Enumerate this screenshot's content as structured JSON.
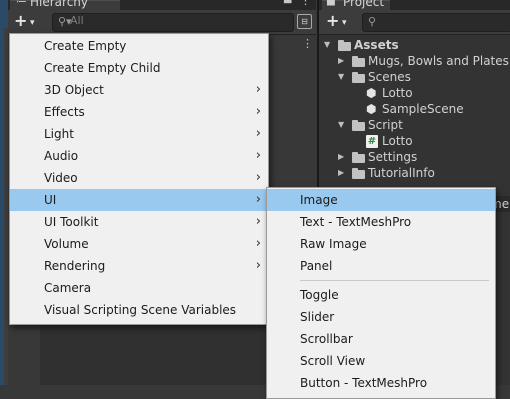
{
  "hierarchy": {
    "tab_icon": "≔",
    "title": "Hierarchy",
    "lock_icon": "🔒",
    "menu_icon": "⋮",
    "add_plus": "+",
    "add_caret": "▾",
    "search_icon": "search-icon",
    "search_prefix": "⚲▾",
    "search_placeholder": "All",
    "filter_icon": "⊟",
    "more_icon": "⋮"
  },
  "project": {
    "tab_icon": "▇",
    "title": "Project",
    "add_plus": "+",
    "add_caret": "▾",
    "search_prefix": "⚲",
    "overflow_text": "me",
    "tree": [
      {
        "label": "Assets",
        "depth": 0,
        "arrow": "▼",
        "icon": "folder-open-icon"
      },
      {
        "label": "Mugs, Bowls and Plates",
        "depth": 1,
        "arrow": "▶",
        "icon": "folder-icon"
      },
      {
        "label": "Scenes",
        "depth": 1,
        "arrow": "▼",
        "icon": "folder-open-icon"
      },
      {
        "label": "Lotto",
        "depth": 2,
        "arrow": "",
        "icon": "unity-scene-icon"
      },
      {
        "label": "SampleScene",
        "depth": 2,
        "arrow": "",
        "icon": "unity-scene-icon"
      },
      {
        "label": "Script",
        "depth": 1,
        "arrow": "▼",
        "icon": "folder-open-icon"
      },
      {
        "label": "Lotto",
        "depth": 2,
        "arrow": "",
        "icon": "csharp-script-icon"
      },
      {
        "label": "Settings",
        "depth": 1,
        "arrow": "▶",
        "icon": "folder-icon"
      },
      {
        "label": "TutorialInfo",
        "depth": 1,
        "arrow": "▶",
        "icon": "folder-icon"
      }
    ]
  },
  "create_menu": {
    "items": [
      {
        "label": "Create Empty",
        "submenu": false
      },
      {
        "label": "Create Empty Child",
        "submenu": false
      },
      {
        "label": "3D Object",
        "submenu": true
      },
      {
        "label": "Effects",
        "submenu": true
      },
      {
        "label": "Light",
        "submenu": true
      },
      {
        "label": "Audio",
        "submenu": true
      },
      {
        "label": "Video",
        "submenu": true
      },
      {
        "label": "UI",
        "submenu": true,
        "highlighted": true
      },
      {
        "label": "UI Toolkit",
        "submenu": true
      },
      {
        "label": "Volume",
        "submenu": true
      },
      {
        "label": "Rendering",
        "submenu": true
      },
      {
        "label": "Camera",
        "submenu": false
      },
      {
        "label": "Visual Scripting Scene Variables",
        "submenu": false
      }
    ],
    "arrow_glyph": "›"
  },
  "ui_submenu": {
    "items": [
      {
        "label": "Image",
        "highlighted": true
      },
      {
        "label": "Text - TextMeshPro"
      },
      {
        "label": "Raw Image"
      },
      {
        "label": "Panel"
      },
      {
        "label": "Toggle"
      },
      {
        "label": "Slider"
      },
      {
        "label": "Scrollbar"
      },
      {
        "label": "Scroll View"
      },
      {
        "label": "Button - TextMeshPro"
      }
    ]
  },
  "colors": {
    "menu_bg": "#f0f0f0",
    "highlight": "#99c9ef",
    "panel_bg": "#383838",
    "project_bg": "#333333"
  }
}
